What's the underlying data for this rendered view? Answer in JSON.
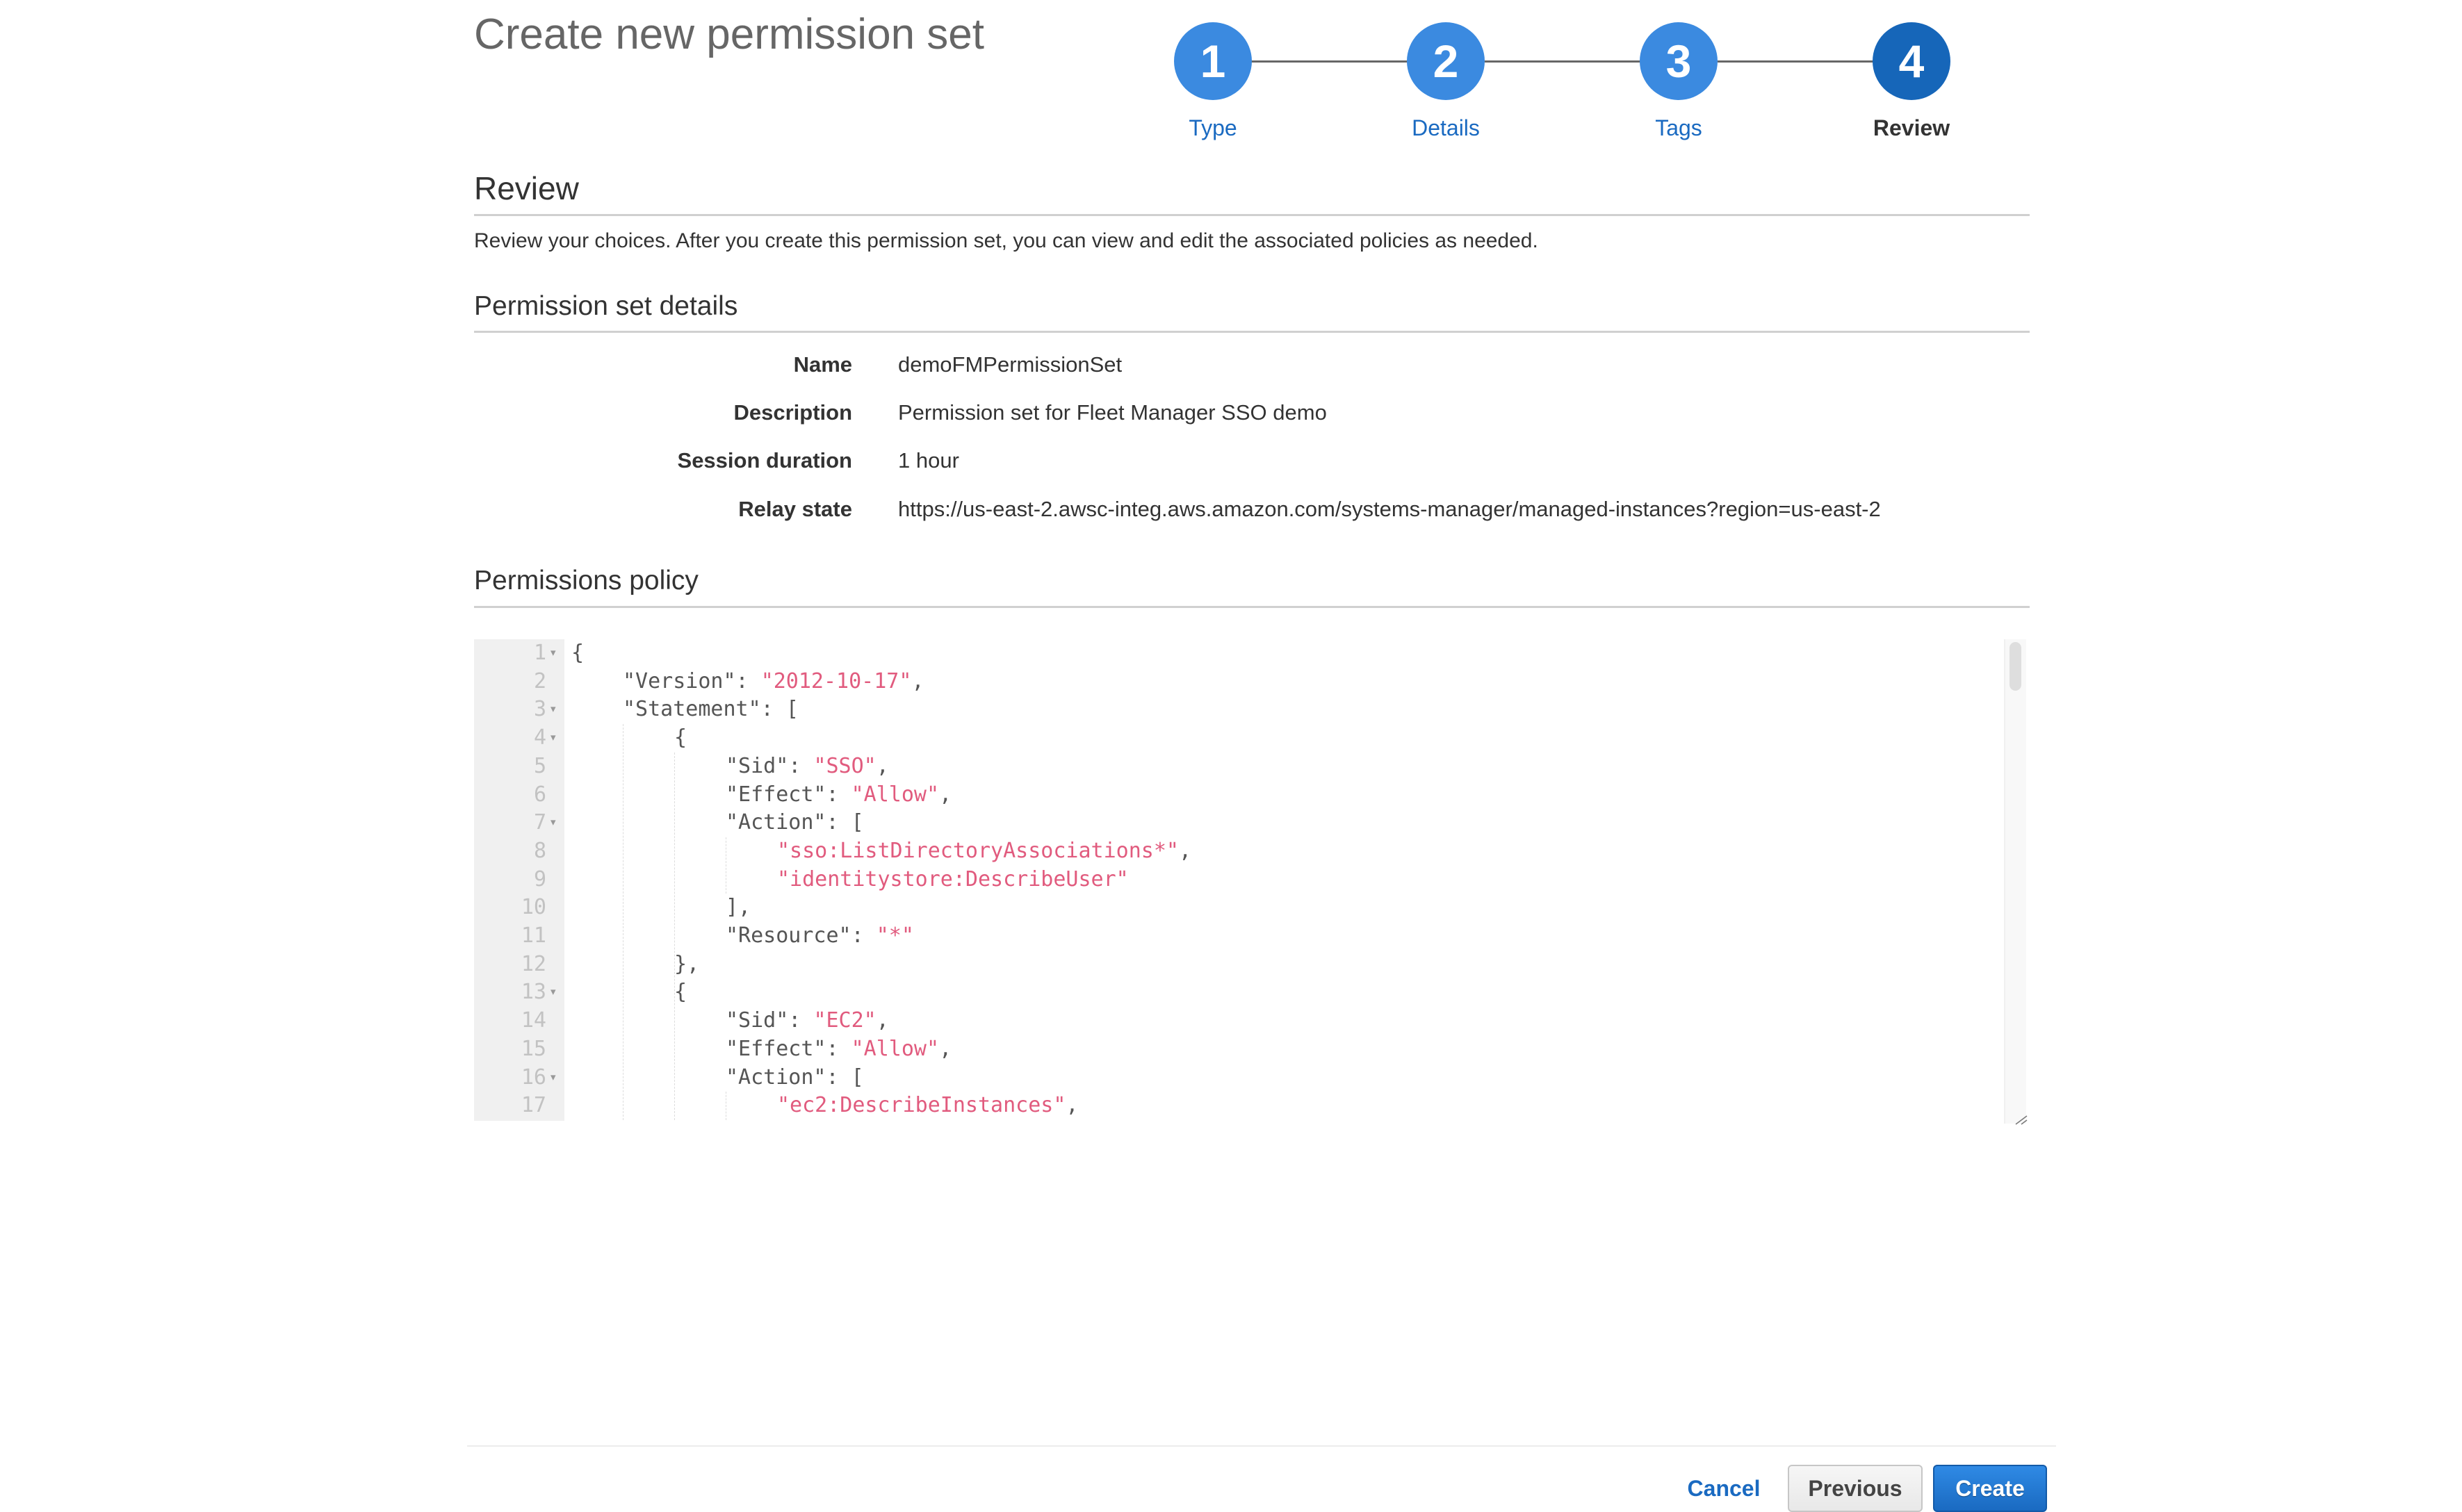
{
  "page": {
    "title": "Create new permission set"
  },
  "stepper": {
    "steps": [
      {
        "number": "1",
        "label": "Type",
        "state": "completed"
      },
      {
        "number": "2",
        "label": "Details",
        "state": "completed"
      },
      {
        "number": "3",
        "label": "Tags",
        "state": "completed"
      },
      {
        "number": "4",
        "label": "Review",
        "state": "active"
      }
    ]
  },
  "review": {
    "heading": "Review",
    "description": "Review your choices. After you create this permission set, you can view and edit the associated policies as needed."
  },
  "details": {
    "heading": "Permission set details",
    "rows": [
      {
        "label": "Name",
        "value": "demoFMPermissionSet"
      },
      {
        "label": "Description",
        "value": "Permission set for Fleet Manager SSO demo"
      },
      {
        "label": "Session duration",
        "value": "1 hour"
      },
      {
        "label": "Relay state",
        "value": "https://us-east-2.awsc-integ.aws.amazon.com/systems-manager/managed-instances?region=us-east-2"
      }
    ]
  },
  "policy": {
    "heading": "Permissions policy",
    "lines": [
      {
        "n": "1",
        "fold": true,
        "indent": 0,
        "key": "",
        "text": "{",
        "str": "",
        "tail": ""
      },
      {
        "n": "2",
        "fold": false,
        "indent": 1,
        "key": "\"Version\": ",
        "text": "",
        "str": "\"2012-10-17\"",
        "tail": ","
      },
      {
        "n": "3",
        "fold": true,
        "indent": 1,
        "key": "\"Statement\": ",
        "text": "[",
        "str": "",
        "tail": ""
      },
      {
        "n": "4",
        "fold": true,
        "indent": 2,
        "key": "",
        "text": "{",
        "str": "",
        "tail": ""
      },
      {
        "n": "5",
        "fold": false,
        "indent": 3,
        "key": "\"Sid\": ",
        "text": "",
        "str": "\"SSO\"",
        "tail": ","
      },
      {
        "n": "6",
        "fold": false,
        "indent": 3,
        "key": "\"Effect\": ",
        "text": "",
        "str": "\"Allow\"",
        "tail": ","
      },
      {
        "n": "7",
        "fold": true,
        "indent": 3,
        "key": "\"Action\": ",
        "text": "[",
        "str": "",
        "tail": ""
      },
      {
        "n": "8",
        "fold": false,
        "indent": 4,
        "key": "",
        "text": "",
        "str": "\"sso:ListDirectoryAssociations*\"",
        "tail": ","
      },
      {
        "n": "9",
        "fold": false,
        "indent": 4,
        "key": "",
        "text": "",
        "str": "\"identitystore:DescribeUser\"",
        "tail": ""
      },
      {
        "n": "10",
        "fold": false,
        "indent": 3,
        "key": "",
        "text": "],",
        "str": "",
        "tail": ""
      },
      {
        "n": "11",
        "fold": false,
        "indent": 3,
        "key": "\"Resource\": ",
        "text": "",
        "str": "\"*\"",
        "tail": ""
      },
      {
        "n": "12",
        "fold": false,
        "indent": 2,
        "key": "",
        "text": "},",
        "str": "",
        "tail": ""
      },
      {
        "n": "13",
        "fold": true,
        "indent": 2,
        "key": "",
        "text": "{",
        "str": "",
        "tail": ""
      },
      {
        "n": "14",
        "fold": false,
        "indent": 3,
        "key": "\"Sid\": ",
        "text": "",
        "str": "\"EC2\"",
        "tail": ","
      },
      {
        "n": "15",
        "fold": false,
        "indent": 3,
        "key": "\"Effect\": ",
        "text": "",
        "str": "\"Allow\"",
        "tail": ","
      },
      {
        "n": "16",
        "fold": true,
        "indent": 3,
        "key": "\"Action\": ",
        "text": "[",
        "str": "",
        "tail": ""
      },
      {
        "n": "17",
        "fold": false,
        "indent": 4,
        "key": "",
        "text": "",
        "str": "\"ec2:DescribeInstances\"",
        "tail": ","
      }
    ]
  },
  "footer": {
    "cancel_label": "Cancel",
    "previous_label": "Previous",
    "create_label": "Create"
  },
  "colors": {
    "accent": "#1a6ac1",
    "step_completed": "#3b8ae0",
    "step_active": "#1666b9",
    "code_string": "#e15b7e"
  }
}
